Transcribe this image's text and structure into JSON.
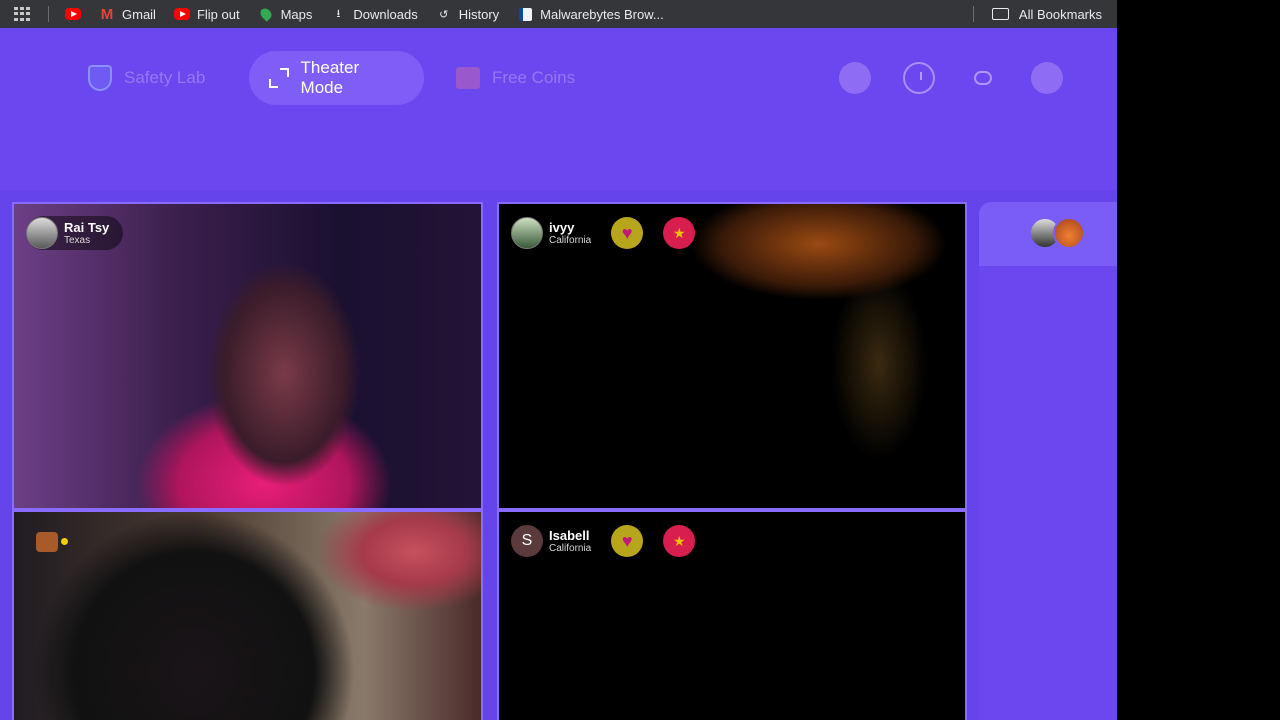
{
  "bookmarks_bar": {
    "items": [
      {
        "label": "",
        "icon": "youtube-icon"
      },
      {
        "label": "Gmail",
        "icon": "gmail-icon"
      },
      {
        "label": "Flip out",
        "icon": "youtube-icon"
      },
      {
        "label": "Maps",
        "icon": "maps-icon"
      },
      {
        "label": "Downloads",
        "icon": "download-icon"
      },
      {
        "label": "History",
        "icon": "history-icon"
      },
      {
        "label": "Malwarebytes Brow...",
        "icon": "malwarebytes-icon"
      }
    ],
    "all_bookmarks": "All Bookmarks"
  },
  "nav": {
    "safety_lab": "Safety Lab",
    "theater_mode": "Theater Mode",
    "free_coins": "Free Coins",
    "accent_color": "#6a47ee"
  },
  "tiles": [
    {
      "name": "Rai Tsy",
      "location": "Texas"
    },
    {
      "name": "ivyy",
      "location": "California"
    },
    {
      "name": "",
      "location": ""
    },
    {
      "name": "Isabell",
      "location": "California",
      "avatar_letter": "S"
    }
  ]
}
